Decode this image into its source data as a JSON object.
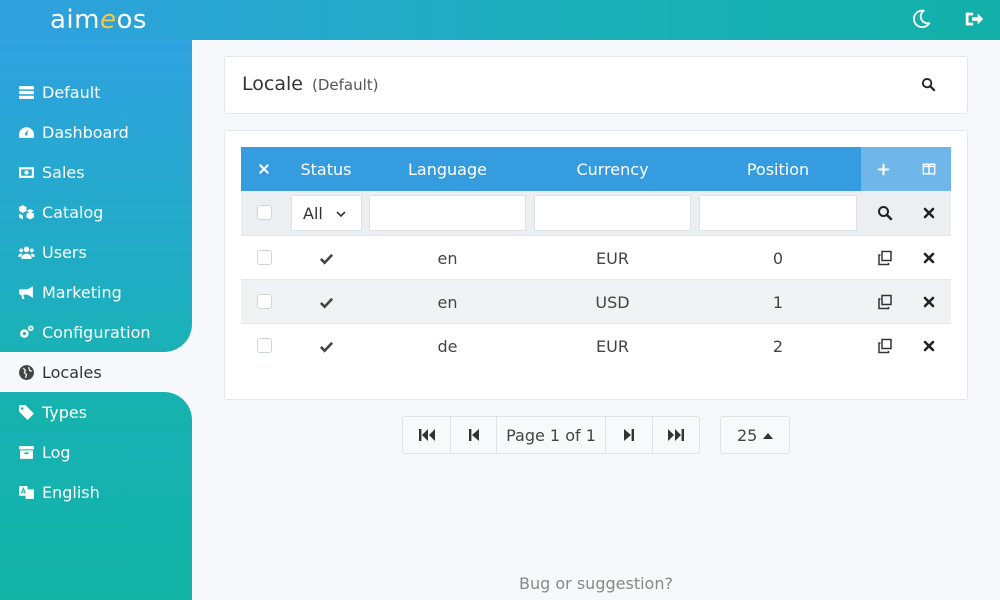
{
  "app": {
    "logo": {
      "pre": "aim",
      "e": "e",
      "post": "os"
    }
  },
  "sidebar": {
    "items": [
      {
        "label": "Default",
        "icon": "server-icon"
      },
      {
        "label": "Dashboard",
        "icon": "gauge-icon"
      },
      {
        "label": "Sales",
        "icon": "money-icon"
      },
      {
        "label": "Catalog",
        "icon": "cubes-icon"
      },
      {
        "label": "Users",
        "icon": "users-icon"
      },
      {
        "label": "Marketing",
        "icon": "bullhorn-icon"
      },
      {
        "label": "Configuration",
        "icon": "cogs-icon"
      },
      {
        "label": "Locales",
        "icon": "globe-icon"
      },
      {
        "label": "Types",
        "icon": "tag-icon"
      },
      {
        "label": "Log",
        "icon": "archive-icon"
      },
      {
        "label": "English",
        "icon": "language-icon"
      }
    ]
  },
  "header": {
    "title": "Locale",
    "subtitle": "(Default)"
  },
  "table": {
    "columns": {
      "status": "Status",
      "language": "Language",
      "currency": "Currency",
      "position": "Position"
    },
    "filter": {
      "status_value": "All"
    },
    "rows": [
      {
        "language": "en",
        "currency": "EUR",
        "position": "0"
      },
      {
        "language": "en",
        "currency": "USD",
        "position": "1"
      },
      {
        "language": "de",
        "currency": "EUR",
        "position": "2"
      }
    ]
  },
  "pagination": {
    "page_label": "Page 1 of 1",
    "page_size": "25"
  },
  "footer": {
    "link": "Bug or suggestion?"
  },
  "colors": {
    "accent": "#359ddf",
    "sidebar_top": "#2fa2e0",
    "sidebar_bottom": "#10b3a4"
  }
}
